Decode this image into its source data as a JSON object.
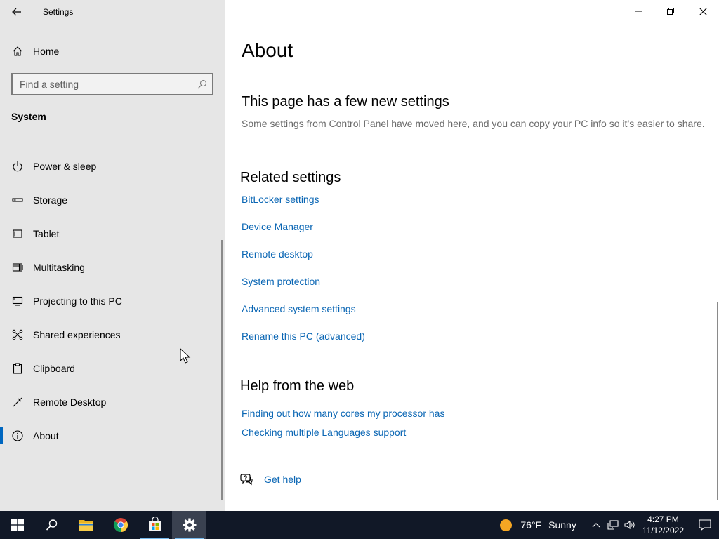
{
  "window": {
    "title": "Settings",
    "controls": [
      "minimize",
      "restore",
      "close"
    ]
  },
  "sidebar": {
    "home_label": "Home",
    "search_placeholder": "Find a setting",
    "section_title": "System",
    "items": [
      {
        "label": "Power & sleep",
        "icon": "power-icon"
      },
      {
        "label": "Storage",
        "icon": "storage-icon"
      },
      {
        "label": "Tablet",
        "icon": "tablet-icon"
      },
      {
        "label": "Multitasking",
        "icon": "multitasking-icon"
      },
      {
        "label": "Projecting to this PC",
        "icon": "projecting-icon"
      },
      {
        "label": "Shared experiences",
        "icon": "shared-experiences-icon"
      },
      {
        "label": "Clipboard",
        "icon": "clipboard-icon"
      },
      {
        "label": "Remote Desktop",
        "icon": "remote-desktop-icon"
      },
      {
        "label": "About",
        "icon": "info-icon",
        "selected": true
      }
    ]
  },
  "main": {
    "page_title": "About",
    "new_settings_heading": "This page has a few new settings",
    "new_settings_desc": "Some settings from Control Panel have moved here, and you can copy your PC info so it’s easier to share.",
    "related_heading": "Related settings",
    "related_links": [
      "BitLocker settings",
      "Device Manager",
      "Remote desktop",
      "System protection",
      "Advanced system settings",
      "Rename this PC (advanced)"
    ],
    "help_heading": "Help from the web",
    "help_links": [
      "Finding out how many cores my processor has",
      "Checking multiple Languages support"
    ],
    "get_help_label": "Get help"
  },
  "taskbar": {
    "apps": [
      "start",
      "search",
      "file-explorer",
      "chrome",
      "microsoft-store",
      "settings"
    ],
    "active_app": "settings",
    "weather": {
      "temp": "76°F",
      "condition": "Sunny"
    },
    "time": "4:27 PM",
    "date": "11/12/2022"
  },
  "colors": {
    "accent": "#0067c0",
    "link": "#0a66b4",
    "sidebar_bg": "#e6e6e6",
    "taskbar_bg": "#111827"
  }
}
